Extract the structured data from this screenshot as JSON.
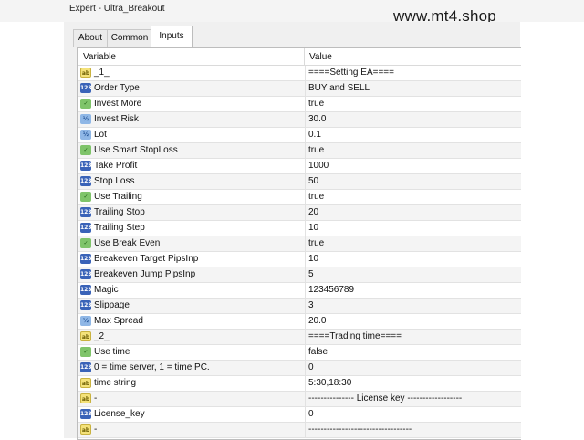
{
  "window": {
    "title": "Expert - Ultra_Breakout"
  },
  "watermark": "www.mt4.shop",
  "tabs": [
    {
      "label": "About"
    },
    {
      "label": "Common"
    },
    {
      "label": "Inputs",
      "active": true
    }
  ],
  "table": {
    "headers": {
      "variable": "Variable",
      "value": "Value"
    },
    "rows": [
      {
        "icon": "ab",
        "name": "_1_",
        "value": "====Setting EA===="
      },
      {
        "icon": "int",
        "name": "Order Type",
        "value": "BUY and SELL"
      },
      {
        "icon": "bool",
        "name": "Invest More",
        "value": "true"
      },
      {
        "icon": "dbl",
        "name": "Invest Risk",
        "value": "30.0"
      },
      {
        "icon": "dbl",
        "name": "Lot",
        "value": "0.1"
      },
      {
        "icon": "bool",
        "name": "Use Smart StopLoss",
        "value": "true"
      },
      {
        "icon": "int",
        "name": "Take Profit",
        "value": "1000"
      },
      {
        "icon": "int",
        "name": "Stop Loss",
        "value": "50"
      },
      {
        "icon": "bool",
        "name": "Use Trailing",
        "value": "true"
      },
      {
        "icon": "int",
        "name": "Trailing Stop",
        "value": "20"
      },
      {
        "icon": "int",
        "name": "Trailing Step",
        "value": "10"
      },
      {
        "icon": "bool",
        "name": "Use Break Even",
        "value": "true"
      },
      {
        "icon": "int",
        "name": "Breakeven Target PipsInp",
        "value": "10"
      },
      {
        "icon": "int",
        "name": "Breakeven Jump PipsInp",
        "value": "5"
      },
      {
        "icon": "int",
        "name": "Magic",
        "value": "123456789"
      },
      {
        "icon": "int",
        "name": "Slippage",
        "value": "3"
      },
      {
        "icon": "dbl",
        "name": "Max Spread",
        "value": "20.0"
      },
      {
        "icon": "ab",
        "name": "_2_",
        "value": "====Trading time===="
      },
      {
        "icon": "bool",
        "name": "Use time",
        "value": "false"
      },
      {
        "icon": "int",
        "name": "0 = time server, 1 = time PC.",
        "value": "0"
      },
      {
        "icon": "ab",
        "name": "time string",
        "value": "5:30,18:30"
      },
      {
        "icon": "ab",
        "name": "-",
        "value": "--------------- License key ------------------"
      },
      {
        "icon": "int",
        "name": "License_key",
        "value": "0"
      },
      {
        "icon": "ab",
        "name": "-",
        "value": "----------------------------------"
      }
    ]
  },
  "icon_glyphs": {
    "ab": "ab",
    "int": "123",
    "dbl": "½",
    "bool": "✓"
  }
}
